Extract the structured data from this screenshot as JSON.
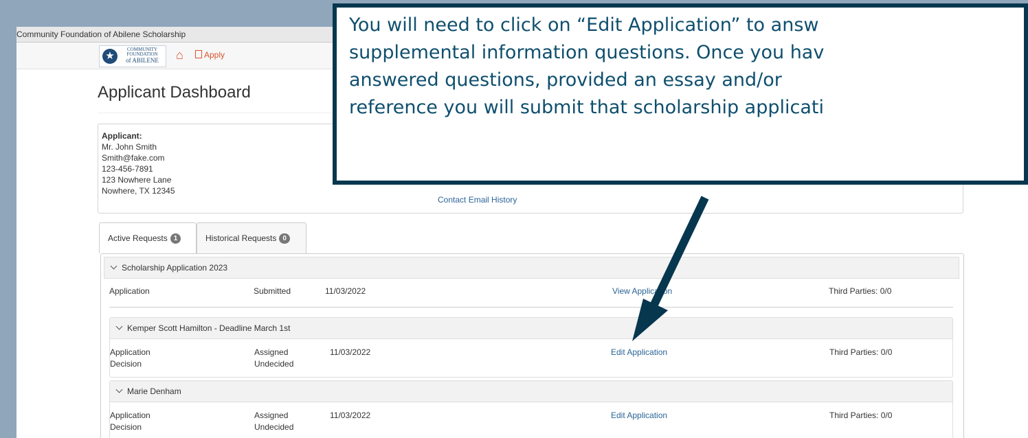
{
  "window": {
    "title": "Community Foundation of Abilene Scholarship"
  },
  "nav": {
    "logo_line1": "COMMUNITY",
    "logo_line2": "FOUNDATION",
    "logo_line3": "of ABILENE",
    "home_icon": "home-icon",
    "apply_label": "Apply"
  },
  "page": {
    "title": "Applicant Dashboard"
  },
  "applicant": {
    "heading": "Applicant:",
    "name": "Mr. John Smith",
    "email": "Smith@fake.com",
    "phone": "123-456-7891",
    "address1": "123 Nowhere Lane",
    "address2": "Nowhere, TX 12345",
    "contact_link": "Contact Email History"
  },
  "tabs": [
    {
      "label": "Active Requests",
      "count": "1"
    },
    {
      "label": "Historical Requests",
      "count": "0"
    }
  ],
  "scholarship": {
    "title": "Scholarship Application 2023",
    "row": {
      "type": "Application",
      "status": "Submitted",
      "date": "11/03/2022",
      "action": "View Application",
      "third": "Third Parties: 0/0"
    }
  },
  "sections": [
    {
      "title": "Kemper Scott Hamilton - Deadline March 1st",
      "type1": "Application",
      "type2": "Decision",
      "status1": "Assigned",
      "status2": "Undecided",
      "date": "11/03/2022",
      "action": "Edit Application",
      "third": "Third Parties: 0/0"
    },
    {
      "title": "Marie Denham",
      "type1": "Application",
      "type2": "Decision",
      "status1": "Assigned",
      "status2": "Undecided",
      "date": "11/03/2022",
      "action": "Edit Application",
      "third": "Third Parties: 0/0"
    }
  ],
  "callout": {
    "line1": "You will need to click on “Edit Application” to answ",
    "line2": "supplemental information questions. Once you hav",
    "line3": "answered questions, provided an essay and/or",
    "line4": "reference you will submit that scholarship applicati"
  },
  "colors": {
    "callout_border": "#07374f",
    "callout_text": "#0f4f6e",
    "link": "#2a6496",
    "accent": "#d9532b"
  }
}
